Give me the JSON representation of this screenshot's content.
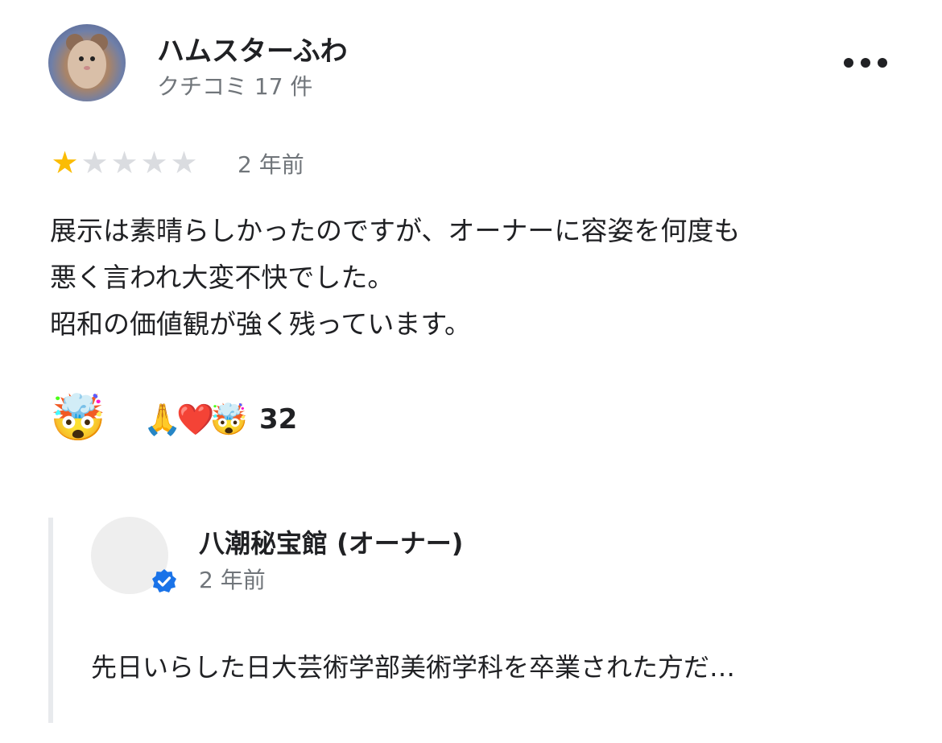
{
  "reviewer": {
    "name": "ハムスターふわ",
    "review_count": "クチコミ 17 件",
    "avatar_icon": "hamster-photo"
  },
  "review": {
    "rating": 1,
    "max_rating": 5,
    "age": "2 年前",
    "text_lines": [
      "展示は素晴らしかったのですが、オーナーに容姿を何度も",
      "悪く言われ大変不快でした。",
      "昭和の価値観が強く残っています。"
    ]
  },
  "reactions": {
    "my_reaction": "🤯",
    "summary_emojis": "🙏❤️🤯",
    "count": "32"
  },
  "owner_reply": {
    "name": "八潮秘宝館 (オーナー)",
    "age": "2 年前",
    "text": "先日いらした日大芸術学部美術学科を卒業された方だ…",
    "verified": true,
    "badge_color": "#1a73e8"
  },
  "colors": {
    "star_filled": "#fbbc04",
    "star_empty": "#dadce0",
    "secondary_text": "#70757a"
  }
}
